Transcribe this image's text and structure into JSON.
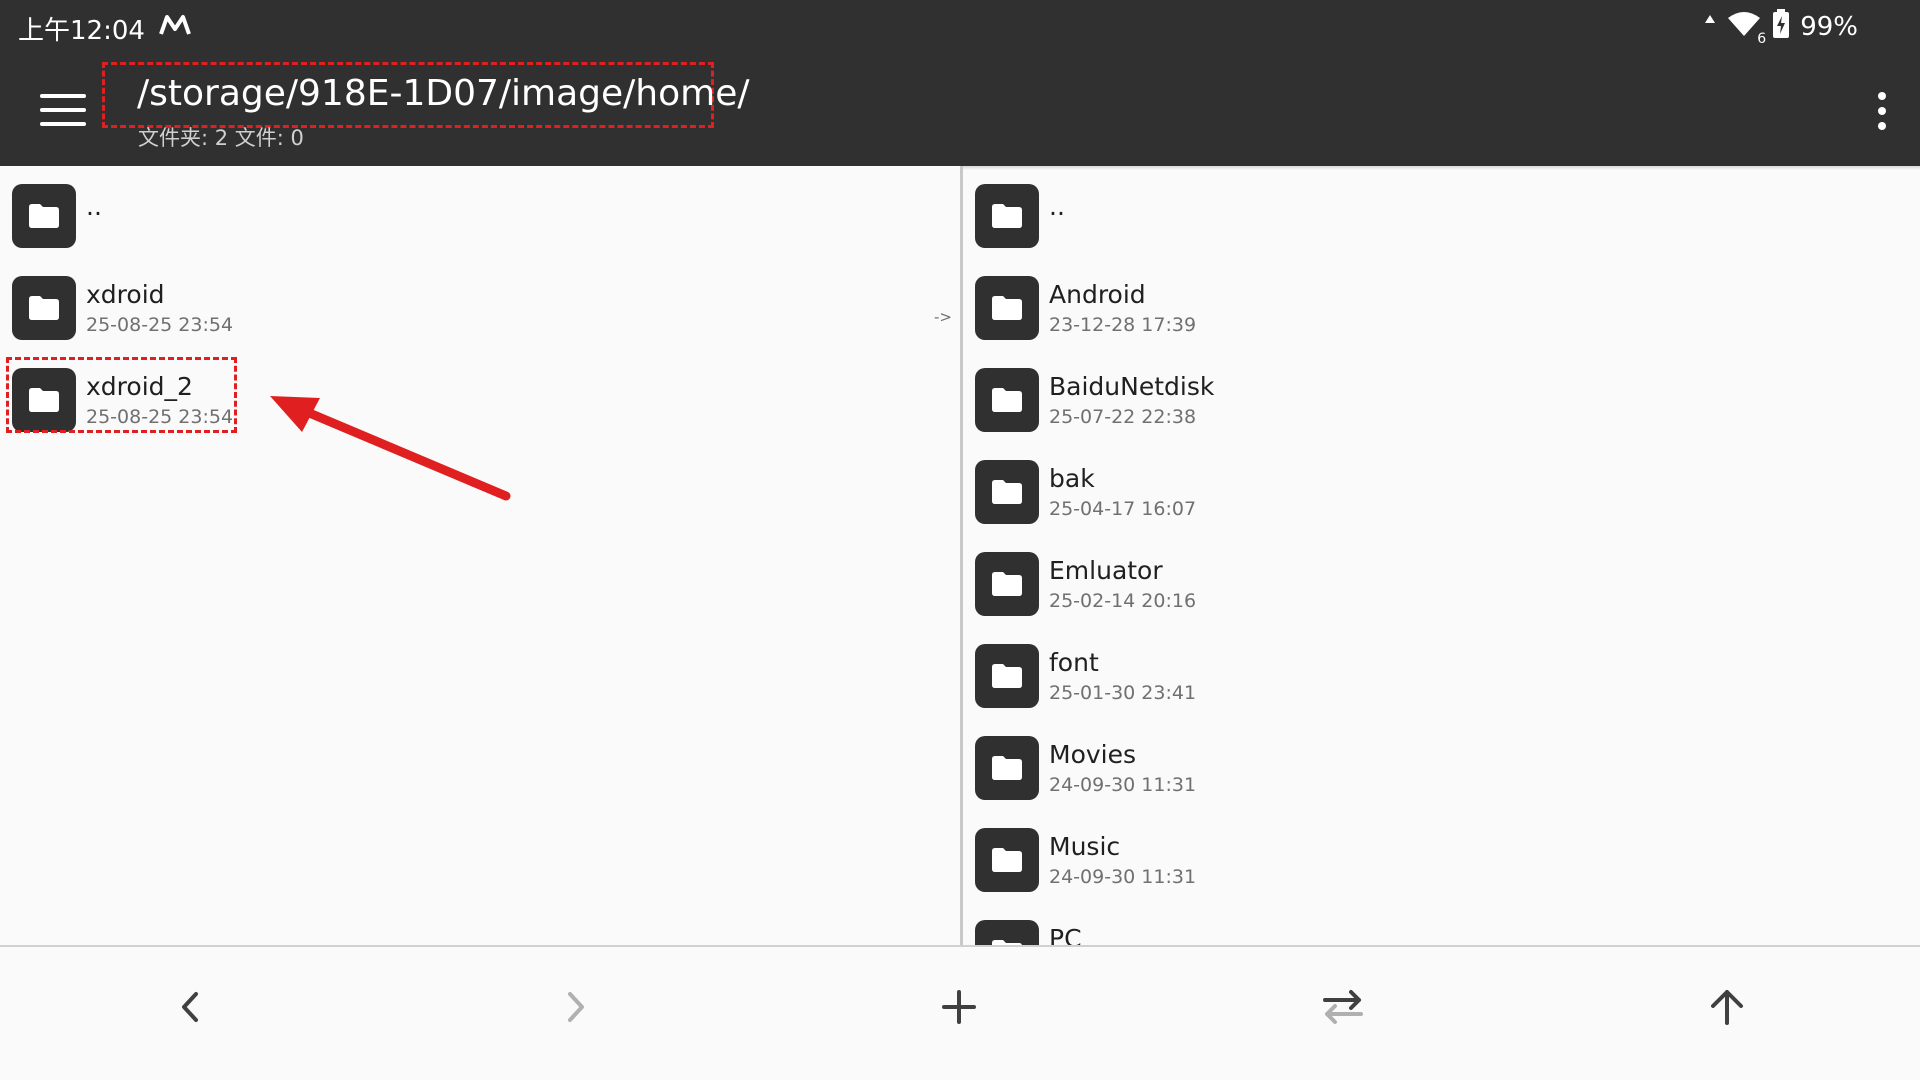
{
  "status_bar": {
    "time": "上午12:04",
    "app_icon": "m-logo-icon",
    "battery": "99%",
    "wifi_badge": "6",
    "icons": [
      "signal-up-icon",
      "wifi-icon",
      "battery-charging-icon"
    ]
  },
  "toolbar": {
    "menu_icon": "hamburger-menu-icon",
    "path": "/storage/918E-1D07/image/home/",
    "summary": "文件夹: 2  文件: 0",
    "more_icon": "more-vert-icon"
  },
  "left_pane": {
    "items": [
      {
        "name": "..",
        "date": ""
      },
      {
        "name": "xdroid",
        "date": "25-08-25 23:54",
        "arrow": "->"
      },
      {
        "name": "xdroid_2",
        "date": "25-08-25 23:54"
      }
    ]
  },
  "right_pane": {
    "items": [
      {
        "name": "..",
        "date": ""
      },
      {
        "name": "Android",
        "date": "23-12-28 17:39"
      },
      {
        "name": "BaiduNetdisk",
        "date": "25-07-22 22:38"
      },
      {
        "name": "bak",
        "date": "25-04-17 16:07"
      },
      {
        "name": "Emluator",
        "date": "25-02-14 20:16"
      },
      {
        "name": "font",
        "date": "25-01-30 23:41"
      },
      {
        "name": "Movies",
        "date": "24-09-30 11:31"
      },
      {
        "name": "Music",
        "date": "24-09-30 11:31"
      },
      {
        "name": "PC",
        "date": ""
      }
    ]
  },
  "bottom_bar": {
    "buttons": [
      "back-icon",
      "forward-icon",
      "add-icon",
      "swap-icon",
      "up-icon"
    ]
  },
  "colors": {
    "toolbar_bg": "#303030",
    "highlight": "#e02020",
    "folder_icon": "#303030"
  }
}
